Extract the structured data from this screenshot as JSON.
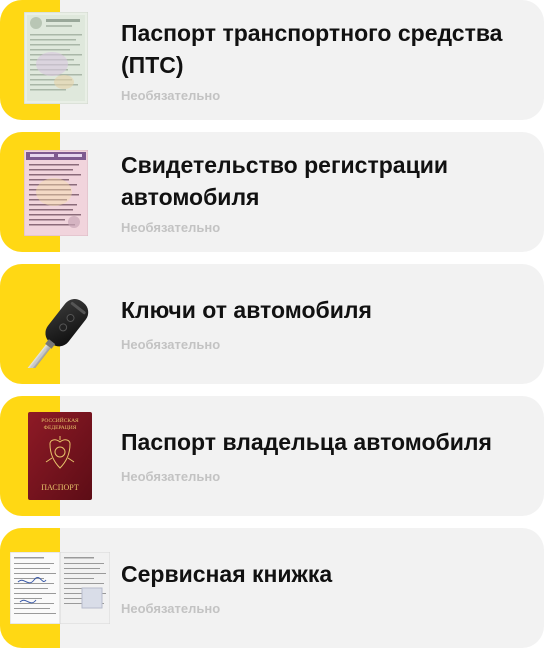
{
  "documents": [
    {
      "title": "Паспорт транспортного средства (ПТС)",
      "status": "Необязательно",
      "icon": "vehicle-passport-icon"
    },
    {
      "title": "Свидетельство регистрации автомобиля",
      "status": "Необязательно",
      "icon": "registration-certificate-icon"
    },
    {
      "title": "Ключи от автомобиля",
      "status": "Необязательно",
      "icon": "car-key-icon"
    },
    {
      "title": "Паспорт владельца автомобиля",
      "status": "Необязательно",
      "icon": "owner-passport-icon"
    },
    {
      "title": "Сервисная книжка",
      "status": "Необязательно",
      "icon": "service-book-icon"
    }
  ],
  "passport_cover": {
    "line1": "РОССИЙСКАЯ",
    "line2": "ФЕДЕРАЦИЯ",
    "label": "ПАСПОРТ"
  },
  "colors": {
    "accent": "#ffd814",
    "card_bg": "#f2f2f2",
    "status_text": "#c3c3c3",
    "title_text": "#111111",
    "passport": "#7a1420"
  }
}
